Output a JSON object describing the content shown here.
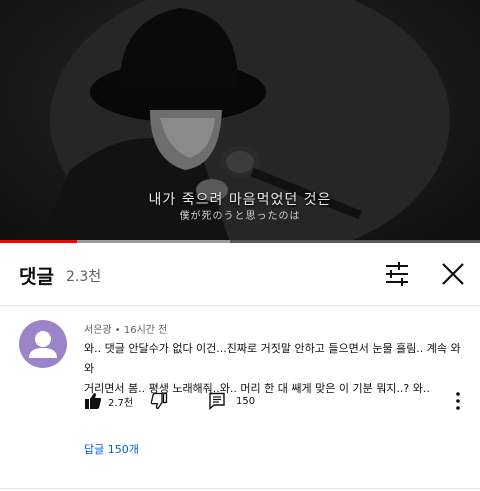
{
  "video": {
    "subtitle_ko": "내가 죽으려 마음먹었던 것은",
    "subtitle_jp": "僕が死のうと思ったのは",
    "progress": 0.16,
    "buffered": 0.48
  },
  "comments_panel": {
    "title": "댓글",
    "count": "2.3천",
    "filter_icon": "sort-sliders-icon",
    "close_icon": "close-icon"
  },
  "comment": {
    "author": "서은광",
    "time": "16시간 전",
    "line1": "와.. 댓글 안달수가 없다 이건...진짜로 거짓말 안하고 들으면서 눈물 흘림.. 계속 와와",
    "line2": "거리면서 봄.. 평생 노래해줘..와.. 머리 한 대 쌔게 맞은 이 기분 뭐지..? 와..",
    "likes": "2.7천",
    "replies_count": "150",
    "replies_link": "답글 150개"
  },
  "colors": {
    "accent_red": "#ff0000",
    "link_blue": "#065fd4",
    "avatar_bg": "#9c84c8"
  }
}
